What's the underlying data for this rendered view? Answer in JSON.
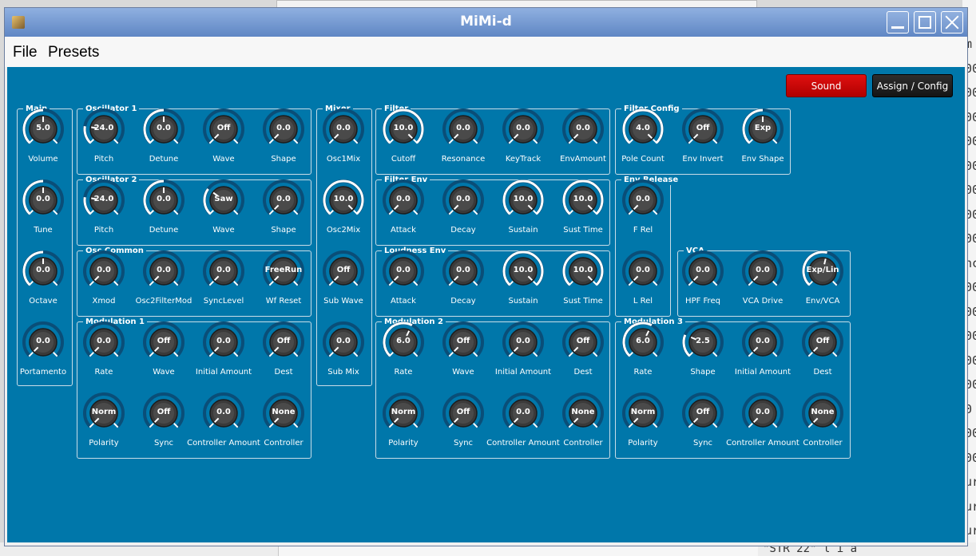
{
  "window": {
    "title": "MiMi-d"
  },
  "menu": [
    {
      "label": "File"
    },
    {
      "label": "Presets"
    }
  ],
  "header_buttons": {
    "sound": "Sound",
    "assign": "Assign / Config"
  },
  "background_right": {
    "lines": [
      "m",
      "00",
      "00",
      "00",
      "00",
      "00",
      "00",
      "00",
      "00",
      "nc",
      "00",
      "00",
      "00",
      "00",
      "00",
      "0",
      "00",
      "00",
      "ur",
      "ur",
      "ur"
    ]
  },
  "background_bottom": {
    "text": "\"STR  22\"  l  i  a"
  },
  "groups": [
    {
      "id": "main",
      "label": "Main",
      "knobs": [
        {
          "label": "Volume",
          "value": "5.0",
          "level": 0.5
        },
        {
          "label": "Tune",
          "value": "0.0",
          "level": 0.5
        },
        {
          "label": "Octave",
          "value": "0.0",
          "level": 0.5
        },
        {
          "label": "Portamento",
          "value": "0.0",
          "level": 0
        }
      ]
    },
    {
      "id": "osc1",
      "label": "Oscillator 1",
      "knobs": [
        {
          "label": "Pitch",
          "value": "24.0",
          "level": 0.2
        },
        {
          "label": "Detune",
          "value": "0.0",
          "level": 0.5
        },
        {
          "label": "Wave",
          "value": "Off",
          "level": 0
        },
        {
          "label": "Shape",
          "value": "0.0",
          "level": 0
        }
      ]
    },
    {
      "id": "osc2",
      "label": "Oscillator 2",
      "knobs": [
        {
          "label": "Pitch",
          "value": "24.0",
          "level": 0.2
        },
        {
          "label": "Detune",
          "value": "0.0",
          "level": 0.5
        },
        {
          "label": "Wave",
          "value": "Saw",
          "level": 0.3
        },
        {
          "label": "Shape",
          "value": "0.0",
          "level": 0
        }
      ]
    },
    {
      "id": "osc_common",
      "label": "Osc Common",
      "knobs": [
        {
          "label": "Xmod",
          "value": "0.0",
          "level": 0
        },
        {
          "label": "Osc2FilterMod",
          "value": "0.0",
          "level": 0
        },
        {
          "label": "SyncLevel",
          "value": "0.0",
          "level": 0
        },
        {
          "label": "Wf Reset",
          "value": "FreeRun",
          "level": 0
        }
      ]
    },
    {
      "id": "mod1",
      "label": "Modulation 1",
      "knobs": [
        {
          "label": "Rate",
          "value": "0.0",
          "level": 0
        },
        {
          "label": "Wave",
          "value": "Off",
          "level": 0
        },
        {
          "label": "Initial Amount",
          "value": "0.0",
          "level": 0
        },
        {
          "label": "Dest",
          "value": "Off",
          "level": 0
        },
        {
          "label": "Polarity",
          "value": "Norm",
          "level": 0
        },
        {
          "label": "Sync",
          "value": "Off",
          "level": 0
        },
        {
          "label": "Controller Amount",
          "value": "0.0",
          "level": 0
        },
        {
          "label": "Controller",
          "value": "None",
          "level": 0
        }
      ]
    },
    {
      "id": "mixer",
      "label": "Mixer",
      "knobs": [
        {
          "label": "Osc1Mix",
          "value": "0.0",
          "level": 0
        },
        {
          "label": "Osc2Mix",
          "value": "10.0",
          "level": 1
        },
        {
          "label": "Sub Wave",
          "value": "Off",
          "level": 0
        },
        {
          "label": "Sub Mix",
          "value": "0.0",
          "level": 0
        }
      ]
    },
    {
      "id": "filter",
      "label": "Filter",
      "knobs": [
        {
          "label": "Cutoff",
          "value": "10.0",
          "level": 1
        },
        {
          "label": "Resonance",
          "value": "0.0",
          "level": 0
        },
        {
          "label": "KeyTrack",
          "value": "0.0",
          "level": 0
        },
        {
          "label": "EnvAmount",
          "value": "0.0",
          "level": 0
        }
      ]
    },
    {
      "id": "filter_env",
      "label": "Filter Env",
      "knobs": [
        {
          "label": "Attack",
          "value": "0.0",
          "level": 0
        },
        {
          "label": "Decay",
          "value": "0.0",
          "level": 0
        },
        {
          "label": "Sustain",
          "value": "10.0",
          "level": 1
        },
        {
          "label": "Sust Time",
          "value": "10.0",
          "level": 1
        }
      ]
    },
    {
      "id": "loud_env",
      "label": "Loudness Env",
      "knobs": [
        {
          "label": "Attack",
          "value": "0.0",
          "level": 0
        },
        {
          "label": "Decay",
          "value": "0.0",
          "level": 0
        },
        {
          "label": "Sustain",
          "value": "10.0",
          "level": 1
        },
        {
          "label": "Sust Time",
          "value": "10.0",
          "level": 1
        }
      ]
    },
    {
      "id": "mod2",
      "label": "Modulation 2",
      "knobs": [
        {
          "label": "Rate",
          "value": "6.0",
          "level": 0.6
        },
        {
          "label": "Wave",
          "value": "Off",
          "level": 0
        },
        {
          "label": "Initial Amount",
          "value": "0.0",
          "level": 0
        },
        {
          "label": "Dest",
          "value": "Off",
          "level": 0
        },
        {
          "label": "Polarity",
          "value": "Norm",
          "level": 0
        },
        {
          "label": "Sync",
          "value": "Off",
          "level": 0
        },
        {
          "label": "Controller Amount",
          "value": "0.0",
          "level": 0
        },
        {
          "label": "Controller",
          "value": "None",
          "level": 0
        }
      ]
    },
    {
      "id": "filter_config",
      "label": "Filter Config",
      "knobs": [
        {
          "label": "Pole Count",
          "value": "4.0",
          "level": 1
        },
        {
          "label": "Env Invert",
          "value": "Off",
          "level": 0
        },
        {
          "label": "Env Shape",
          "value": "Exp",
          "level": 0.5
        }
      ]
    },
    {
      "id": "env_release",
      "label": "Env Release",
      "knobs": [
        {
          "label": "F Rel",
          "value": "0.0",
          "level": 0
        },
        {
          "label": "L Rel",
          "value": "0.0",
          "level": 0
        }
      ]
    },
    {
      "id": "vca",
      "label": "VCA",
      "knobs": [
        {
          "label": "HPF Freq",
          "value": "0.0",
          "level": 0
        },
        {
          "label": "VCA Drive",
          "value": "0.0",
          "level": 0
        },
        {
          "label": "Env/VCA",
          "value": "Exp/Lin",
          "level": 0.55
        }
      ]
    },
    {
      "id": "mod3",
      "label": "Modulation 3",
      "knobs": [
        {
          "label": "Rate",
          "value": "6.0",
          "level": 0.6
        },
        {
          "label": "Shape",
          "value": "2.5",
          "level": 0.25
        },
        {
          "label": "Initial Amount",
          "value": "0.0",
          "level": 0
        },
        {
          "label": "Dest",
          "value": "Off",
          "level": 0
        },
        {
          "label": "Polarity",
          "value": "Norm",
          "level": 0
        },
        {
          "label": "Sync",
          "value": "Off",
          "level": 0
        },
        {
          "label": "Controller Amount",
          "value": "0.0",
          "level": 0
        },
        {
          "label": "Controller",
          "value": "None",
          "level": 0
        }
      ]
    }
  ]
}
